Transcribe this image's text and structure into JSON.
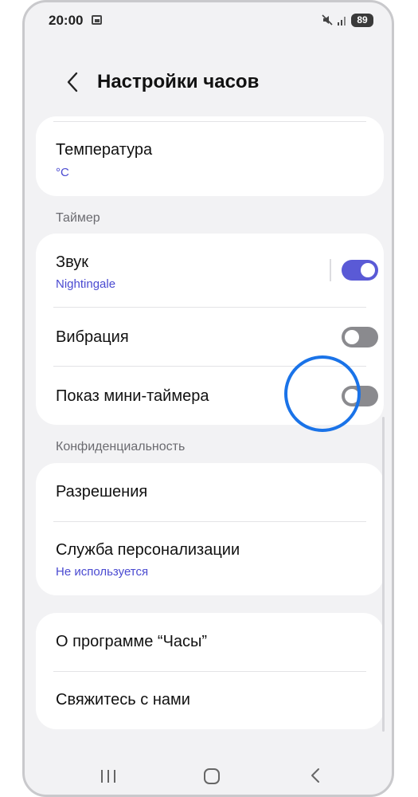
{
  "status_bar": {
    "time": "20:00",
    "battery": "89"
  },
  "header": {
    "title": "Настройки часов"
  },
  "temperature": {
    "title": "Температура",
    "value": "°C"
  },
  "timer_section": {
    "label": "Таймер",
    "sound": {
      "title": "Звук",
      "value": "Nightingale",
      "enabled": true
    },
    "vibration": {
      "title": "Вибрация",
      "enabled": false
    },
    "mini_timer": {
      "title": "Показ мини-таймера",
      "enabled": false
    }
  },
  "privacy_section": {
    "label": "Конфиденциальность",
    "permissions": {
      "title": "Разрешения"
    },
    "personalization": {
      "title": "Служба персонализации",
      "value": "Не используется"
    }
  },
  "about": {
    "title": "О программе “Часы”"
  },
  "contact": {
    "title": "Свяжитесь с нами"
  },
  "colors": {
    "accent": "#5a5ad6",
    "link": "#4a4ad1",
    "highlight": "#1a73e8"
  }
}
